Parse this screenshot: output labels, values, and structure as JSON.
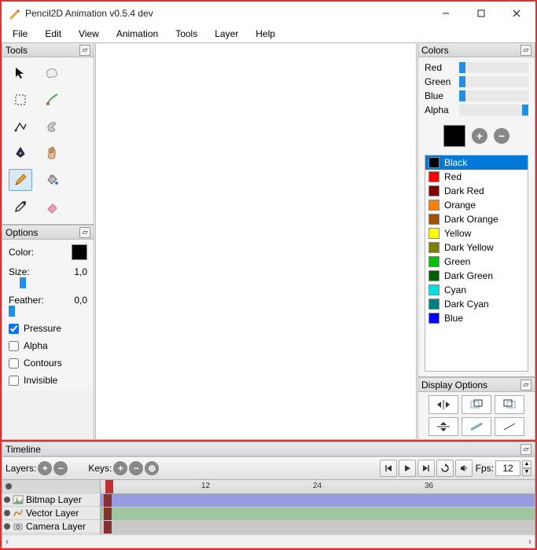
{
  "window": {
    "title": "Pencil2D Animation v0.5.4 dev"
  },
  "menus": [
    "File",
    "Edit",
    "View",
    "Animation",
    "Tools",
    "Layer",
    "Help"
  ],
  "panels": {
    "tools_title": "Tools",
    "options_title": "Options",
    "colors_title": "Colors",
    "display_title": "Display Options",
    "timeline_title": "Timeline"
  },
  "options": {
    "color_label": "Color:",
    "size_label": "Size:",
    "size_value": "1,0",
    "feather_label": "Feather:",
    "feather_value": "0,0",
    "pressure": "Pressure",
    "alpha": "Alpha",
    "contours": "Contours",
    "invisible": "Invisible"
  },
  "channels": {
    "red": "Red",
    "green": "Green",
    "blue": "Blue",
    "alpha": "Alpha"
  },
  "palette": [
    {
      "name": "Black",
      "color": "#000000",
      "selected": true
    },
    {
      "name": "Red",
      "color": "#ff0000"
    },
    {
      "name": "Dark Red",
      "color": "#800000"
    },
    {
      "name": "Orange",
      "color": "#ff8000"
    },
    {
      "name": "Dark Orange",
      "color": "#a05000"
    },
    {
      "name": "Yellow",
      "color": "#ffff00"
    },
    {
      "name": "Dark Yellow",
      "color": "#808000"
    },
    {
      "name": "Green",
      "color": "#00c000"
    },
    {
      "name": "Dark Green",
      "color": "#006000"
    },
    {
      "name": "Cyan",
      "color": "#00e0e0"
    },
    {
      "name": "Dark Cyan",
      "color": "#008080"
    },
    {
      "name": "Blue",
      "color": "#0000ff"
    }
  ],
  "timeline": {
    "layers_label": "Layers:",
    "keys_label": "Keys:",
    "fps_label": "Fps:",
    "fps_value": "12",
    "ruler_ticks": [
      "12",
      "24",
      "36"
    ],
    "layers": [
      {
        "name": "Bitmap Layer",
        "track_color": "#9a9ae0"
      },
      {
        "name": "Vector Layer",
        "track_color": "#a0c8a0"
      },
      {
        "name": "Camera Layer",
        "track_color": "#c8c8c8"
      }
    ]
  }
}
